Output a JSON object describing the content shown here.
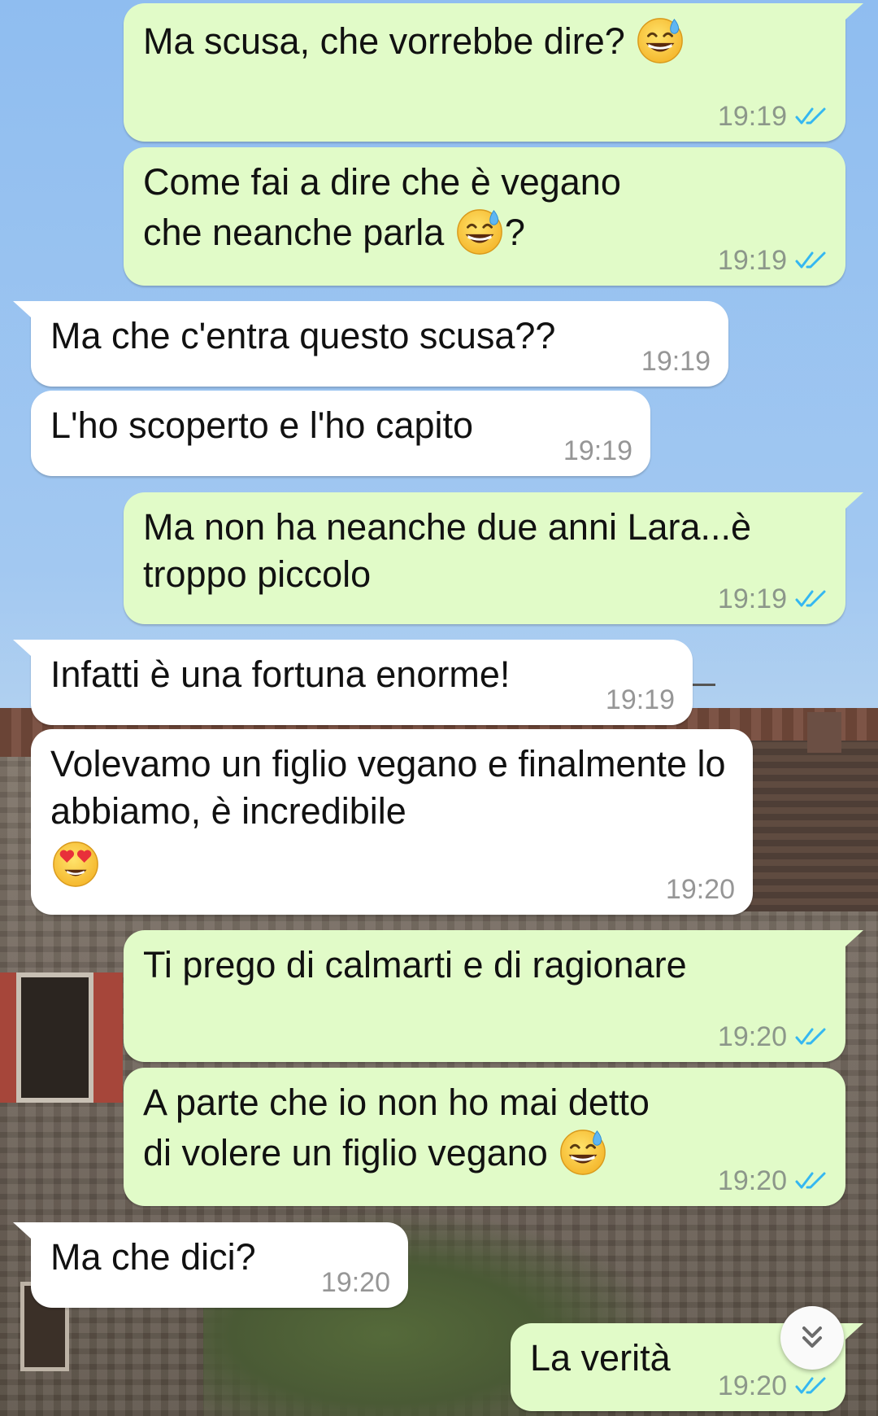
{
  "colors": {
    "outgoing_bubble": "#e1fbc8",
    "incoming_bubble": "#ffffff",
    "read_ticks": "#34b7f1",
    "timestamp": "#8c978a"
  },
  "messages": [
    {
      "direction": "outgoing",
      "text": "Ma scusa, che vorrebbe dire?",
      "emoji": "grinning-face-with-sweat",
      "time": "19:19",
      "status": "read"
    },
    {
      "direction": "outgoing",
      "text": "Come fai a dire che è vegano che neanche parla",
      "emoji": "grinning-face-with-sweat",
      "suffix": "?",
      "time": "19:19",
      "status": "read"
    },
    {
      "direction": "incoming",
      "text": "Ma che c'entra questo scusa??",
      "time": "19:19"
    },
    {
      "direction": "incoming",
      "text": "L'ho scoperto e l'ho capito",
      "time": "19:19"
    },
    {
      "direction": "outgoing",
      "text": "Ma non ha neanche due anni Lara...è troppo piccolo",
      "time": "19:19",
      "status": "read"
    },
    {
      "direction": "incoming",
      "text": "Infatti è una fortuna enorme!",
      "time": "19:19"
    },
    {
      "direction": "incoming",
      "text": "Volevamo un figlio vegano e finalmente lo abbiamo, è incredibile",
      "emoji": "smiling-face-with-heart-eyes",
      "time": "19:20"
    },
    {
      "direction": "outgoing",
      "text": "Ti prego di calmarti e di ragionare",
      "time": "19:20",
      "status": "read"
    },
    {
      "direction": "outgoing",
      "text": "A parte che io non ho mai detto di volere un figlio vegano",
      "emoji": "grinning-face-with-sweat",
      "time": "19:20",
      "status": "read"
    },
    {
      "direction": "incoming",
      "text": "Ma che dici?",
      "time": "19:20"
    },
    {
      "direction": "outgoing",
      "text": "La verità",
      "time": "19:20",
      "status": "read"
    }
  ],
  "scroll_to_bottom": {
    "icon": "double-chevron-down-icon"
  }
}
